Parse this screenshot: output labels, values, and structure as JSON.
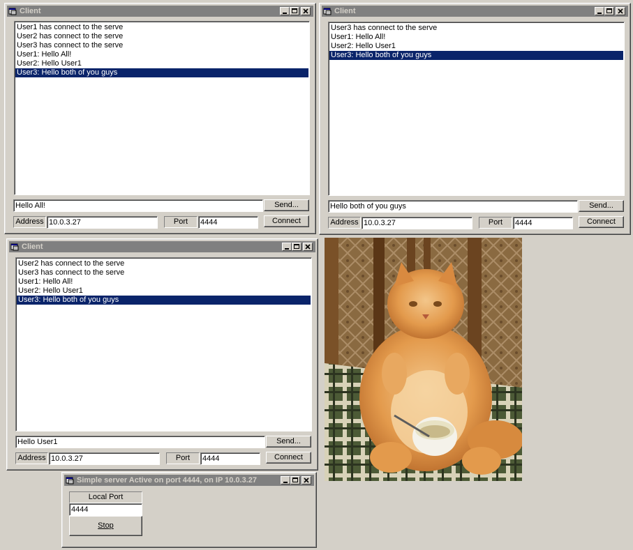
{
  "client1": {
    "title": "Client",
    "messages": [
      "User1 has connect to the serve",
      "User2 has connect to the serve",
      "User3 has connect to the serve",
      "User1: Hello All!",
      "User2: Hello User1",
      "User3: Hello both of you guys"
    ],
    "selected_index": 5,
    "message_value": "Hello All!",
    "send_label": "Send...",
    "address_label": "Address",
    "address_value": "10.0.3.27",
    "port_label": "Port",
    "port_value": "4444",
    "connect_label": "Connect"
  },
  "client2": {
    "title": "Client",
    "messages": [
      "User3 has connect to the serve",
      "User1: Hello All!",
      "User2: Hello User1",
      "User3: Hello both of you guys"
    ],
    "selected_index": 3,
    "message_value": "Hello both of you guys",
    "send_label": "Send...",
    "address_label": "Address",
    "address_value": "10.0.3.27",
    "port_label": "Port",
    "port_value": "4444",
    "connect_label": "Connect"
  },
  "client3": {
    "title": "Client",
    "messages": [
      "User2 has connect to the serve",
      "User3 has connect to the serve",
      "User1: Hello All!",
      "User2: Hello User1",
      "User3: Hello both of you guys"
    ],
    "selected_index": 4,
    "message_value": "Hello User1",
    "send_label": "Send...",
    "address_label": "Address",
    "address_value": "10.0.3.27",
    "port_label": "Port",
    "port_value": "4444",
    "connect_label": "Connect"
  },
  "server": {
    "title": "Simple server Active on port 4444, on IP 10.0.3.27",
    "local_port_label": "Local Port",
    "local_port_value": "4444",
    "stop_label": "Stop"
  },
  "colors": {
    "selection": "#0a246a",
    "inactive_titlebar": "#808080",
    "face": "#d4d0c8"
  }
}
